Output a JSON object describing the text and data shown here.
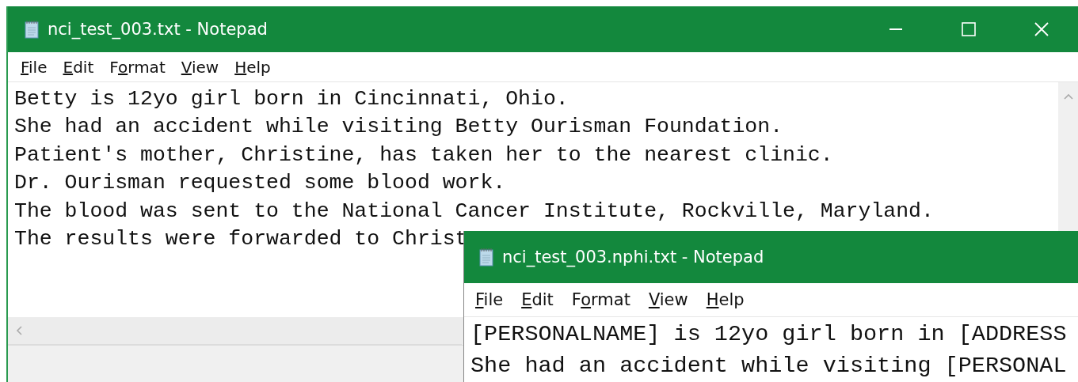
{
  "windows": [
    {
      "kind": "back",
      "title": "nci_test_003.txt - Notepad",
      "menu": [
        {
          "key": "F",
          "after": "ile"
        },
        {
          "key": "E",
          "after": "dit"
        },
        {
          "before": "F",
          "key": "o",
          "after": "rmat"
        },
        {
          "key": "V",
          "after": "iew"
        },
        {
          "key": "H",
          "after": "elp"
        }
      ],
      "lines": [
        "Betty is 12yo girl born in Cincinnati, Ohio.",
        "She had an accident while visiting Betty Ourisman Foundation.",
        "Patient's mother, Christine, has taken her to the nearest clinic.",
        "Dr. Ourisman requested some blood work.",
        "The blood was sent to the National Cancer Institute, Rockville, Maryland.",
        "The results were forwarded to Christ"
      ]
    },
    {
      "kind": "front",
      "title": "nci_test_003.nphi.txt - Notepad",
      "menu": [
        {
          "key": "F",
          "after": "ile"
        },
        {
          "key": "E",
          "after": "dit"
        },
        {
          "before": "F",
          "key": "o",
          "after": "rmat"
        },
        {
          "key": "V",
          "after": "iew"
        },
        {
          "key": "H",
          "after": "elp"
        }
      ],
      "lines": [
        "[PERSONALNAME] is 12yo girl born in [ADDRESS",
        "She had an accident while visiting [PERSONAL"
      ]
    }
  ]
}
